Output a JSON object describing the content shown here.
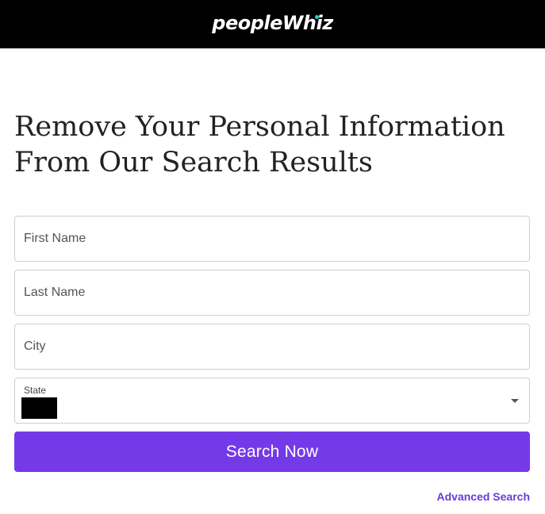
{
  "header": {
    "logo_text": "peopleWhiz",
    "background_color": "#000000",
    "logo_accent_color": "#2ad3c0"
  },
  "main": {
    "title_line1": "Remove Your Personal Information",
    "title_line2": "From Our Search Results"
  },
  "form": {
    "first_name_placeholder": "First Name",
    "last_name_placeholder": "Last Name",
    "city_placeholder": "City",
    "state_label": "State",
    "state_value": "",
    "submit_label": "Search Now",
    "submit_color": "#753ae8"
  },
  "links": {
    "advanced_search": "Advanced Search",
    "link_color": "#6a3bd6"
  }
}
